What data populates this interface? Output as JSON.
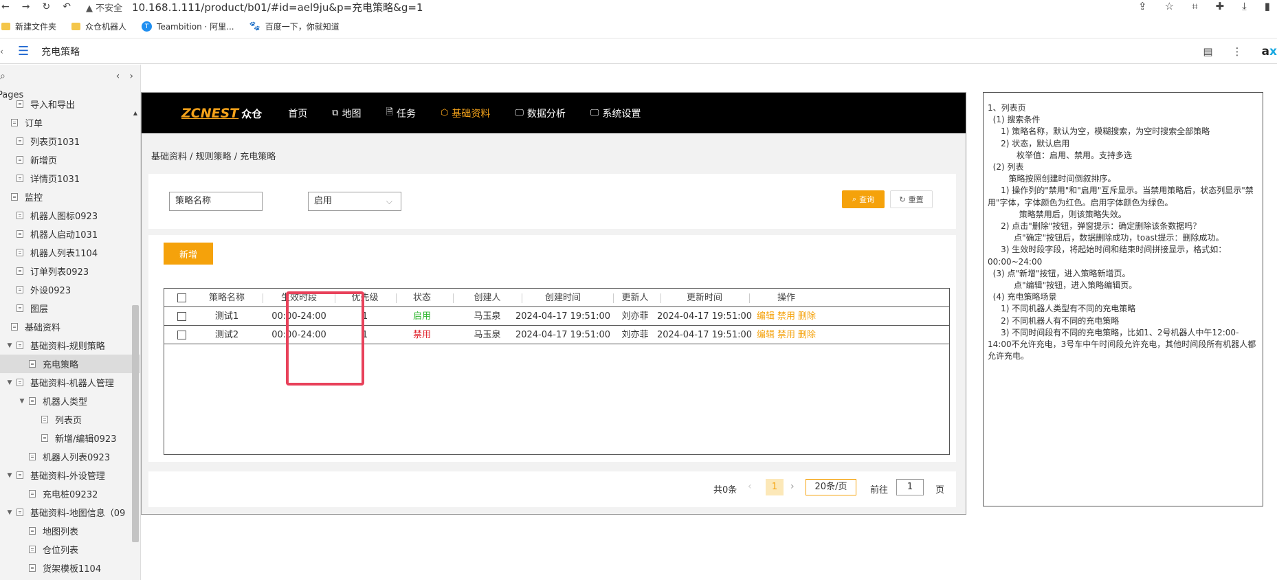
{
  "browser": {
    "insecure_label": "不安全",
    "url": "10.168.1.111/product/b01/#id=ael9ju&p=充电策略&g=1",
    "bookmarks": [
      {
        "label": "新建文件夹"
      },
      {
        "label": "众仓机器人"
      },
      {
        "label": "Teambition · 阿里..."
      },
      {
        "label": "百度一下，你就知道"
      }
    ]
  },
  "axure": {
    "page_title": "充电策略",
    "logo_text": "a",
    "logo_accent": "x",
    "pages_label": "Pages"
  },
  "sidebar": {
    "items": [
      {
        "label": "导入和导出",
        "level": 2,
        "type": "page"
      },
      {
        "label": "订单",
        "level": 1,
        "type": "page"
      },
      {
        "label": "列表页1031",
        "level": 2,
        "type": "page"
      },
      {
        "label": "新增页",
        "level": 2,
        "type": "page"
      },
      {
        "label": "详情页1031",
        "level": 2,
        "type": "page"
      },
      {
        "label": "监控",
        "level": 1,
        "type": "page"
      },
      {
        "label": "机器人图标0923",
        "level": 2,
        "type": "page"
      },
      {
        "label": "机器人启动1031",
        "level": 2,
        "type": "page"
      },
      {
        "label": "机器人列表1104",
        "level": 2,
        "type": "page"
      },
      {
        "label": "订单列表0923",
        "level": 2,
        "type": "page"
      },
      {
        "label": "外设0923",
        "level": 2,
        "type": "page"
      },
      {
        "label": "图层",
        "level": 2,
        "type": "page"
      },
      {
        "label": "基础资料",
        "level": 1,
        "type": "page"
      },
      {
        "label": "基础资料-规则策略",
        "level": 2,
        "type": "folder"
      },
      {
        "label": "充电策略",
        "level": 3,
        "type": "page",
        "selected": true
      },
      {
        "label": "基础资料-机器人管理",
        "level": 2,
        "type": "folder"
      },
      {
        "label": "机器人类型",
        "level": 3,
        "type": "folder"
      },
      {
        "label": "列表页",
        "level": 4,
        "type": "page"
      },
      {
        "label": "新增/编辑0923",
        "level": 4,
        "type": "page"
      },
      {
        "label": "机器人列表0923",
        "level": 3,
        "type": "page"
      },
      {
        "label": "基础资料-外设管理",
        "level": 2,
        "type": "folder"
      },
      {
        "label": "充电桩09232",
        "level": 3,
        "type": "page"
      },
      {
        "label": "基础资料-地图信息（09",
        "level": 2,
        "type": "folder"
      },
      {
        "label": "地图列表",
        "level": 3,
        "type": "page"
      },
      {
        "label": "仓位列表",
        "level": 3,
        "type": "page"
      },
      {
        "label": "货架模板1104",
        "level": 3,
        "type": "page"
      }
    ]
  },
  "app": {
    "brand_en": "ZCNEST",
    "brand_cn": "众仓",
    "nav": [
      {
        "label": "首页",
        "icon": "",
        "active": false
      },
      {
        "label": "地图",
        "icon": "sitemap-icon",
        "active": false
      },
      {
        "label": "任务",
        "icon": "document-icon",
        "active": false
      },
      {
        "label": "基础资料",
        "icon": "cube-icon",
        "active": true
      },
      {
        "label": "数据分析",
        "icon": "monitor-icon",
        "active": false
      },
      {
        "label": "系统设置",
        "icon": "monitor-icon",
        "active": false
      }
    ],
    "breadcrumb": "基础资料 / 规则策略 / 充电策略",
    "filters": {
      "name_placeholder": "策略名称",
      "status_value": "启用",
      "query_label": "查询",
      "reset_label": "重置"
    },
    "add_label": "新增",
    "table": {
      "columns": [
        "策略名称",
        "生效时段",
        "优先级",
        "状态",
        "创建人",
        "创建时间",
        "更新人",
        "更新时间",
        "操作"
      ],
      "rows": [
        {
          "name": "测试1",
          "period": "00:00-24:00",
          "priority": "1",
          "status": "启用",
          "creator": "马玉泉",
          "created": "2024-04-17 19:51:00",
          "updater": "刘亦菲",
          "updated": "2024-04-17 19:51:00",
          "ops": [
            "编辑",
            "禁用",
            "删除"
          ]
        },
        {
          "name": "测试2",
          "period": "00:00-24:00",
          "priority": "1",
          "status": "禁用",
          "creator": "马玉泉",
          "created": "2024-04-17 19:51:00",
          "updater": "刘亦菲",
          "updated": "2024-04-17 19:51:00",
          "ops": [
            "编辑",
            "禁用",
            "删除"
          ]
        }
      ]
    },
    "pagination": {
      "total": "共0条",
      "current": "1",
      "page_size": "20条/页",
      "goto_label": "前往",
      "goto_value": "1",
      "page_unit": "页"
    }
  },
  "notes": [
    "1、列表页",
    "  (1) 搜索条件",
    "     1) 策略名称，默认为空，模糊搜索，为空时搜索全部策略",
    "     2) 状态，默认启用",
    "           枚举值：启用、禁用。支持多选",
    "  (2) 列表",
    "        策略按照创建时间倒叙排序。",
    "     1) 操作列的\"禁用\"和\"启用\"互斥显示。当禁用策略后，状态列显示\"禁用\"字体，字体颜色为红色。启用字体颜色为绿色。",
    "            策略禁用后，则该策略失效。",
    "     2) 点击\"删除\"按钮，弹窗提示：确定删除该条数据吗？",
    "          点\"确定\"按钮后，数据删除成功，toast提示：删除成功。",
    "     3) 生效时段字段，将起始时间和结束时间拼接显示，格式如：00:00~24:00",
    "  (3) 点\"新增\"按钮，进入策略新增页。",
    "          点\"编辑\"按钮，进入策略编辑页。",
    "  (4) 充电策略场景",
    "     1) 不同机器人类型有不同的充电策略",
    "     2) 不同机器人有不同的充电策略",
    "     3) 不同时间段有不同的充电策略，比如1、2号机器人中午12:00-14:00不允许充电，3号车中午时间段允许充电，其他时间段所有机器人都允许充电。"
  ],
  "colors": {
    "accent": "#f5a20b",
    "status_on": "#2bb52b",
    "status_off": "#e0202a",
    "highlight": "#e8415a"
  }
}
